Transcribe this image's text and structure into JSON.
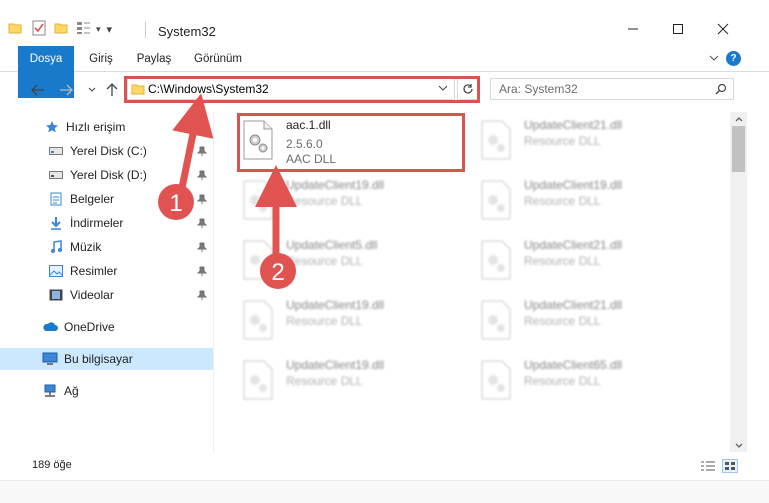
{
  "window": {
    "title": "System32",
    "minimize_icon": "minimize-icon",
    "maximize_icon": "maximize-icon",
    "close_icon": "close-icon"
  },
  "ribbon": {
    "tabs": [
      {
        "label": "Dosya"
      },
      {
        "label": "Giriş"
      },
      {
        "label": "Paylaş"
      },
      {
        "label": "Görünüm"
      }
    ],
    "help": "?"
  },
  "address": {
    "path": "C:\\Windows\\System32",
    "search_placeholder": "Ara: System32"
  },
  "sidebar": {
    "items": [
      {
        "label": "Hızlı erişim"
      },
      {
        "label": "Yerel Disk (C:)"
      },
      {
        "label": "Yerel Disk (D:)"
      },
      {
        "label": "Belgeler"
      },
      {
        "label": "İndirmeler"
      },
      {
        "label": "Müzik"
      },
      {
        "label": "Resimler"
      },
      {
        "label": "Videolar"
      },
      {
        "label": "OneDrive"
      },
      {
        "label": "Bu bilgisayar"
      },
      {
        "label": "Ağ"
      }
    ]
  },
  "files": [
    {
      "name": "aac.1.dll",
      "version": "2.5.6.0",
      "desc": "AAC DLL"
    },
    {
      "name": "UpdateClient21.dll",
      "version": "",
      "desc": "Resource DLL"
    },
    {
      "name": "UpdateClient19.dll",
      "version": "",
      "desc": "Resource DLL"
    },
    {
      "name": "UpdateClient19.dll",
      "version": "",
      "desc": "Resource DLL"
    },
    {
      "name": "UpdateClient5.dll",
      "version": "",
      "desc": "Resource DLL"
    },
    {
      "name": "UpdateClient21.dll",
      "version": "",
      "desc": "Resource DLL"
    },
    {
      "name": "UpdateClient19.dll",
      "version": "",
      "desc": "Resource DLL"
    },
    {
      "name": "UpdateClient21.dll",
      "version": "",
      "desc": "Resource DLL"
    },
    {
      "name": "UpdateClient19.dll",
      "version": "",
      "desc": "Resource DLL"
    },
    {
      "name": "UpdateClient65.dll",
      "version": "",
      "desc": "Resource DLL"
    }
  ],
  "status": {
    "count": "189 öğe"
  },
  "annotations": {
    "step1": "1",
    "step2": "2"
  },
  "colors": {
    "accent": "#1979ca",
    "highlight": "#d9534f",
    "selected": "#cce8ff"
  }
}
